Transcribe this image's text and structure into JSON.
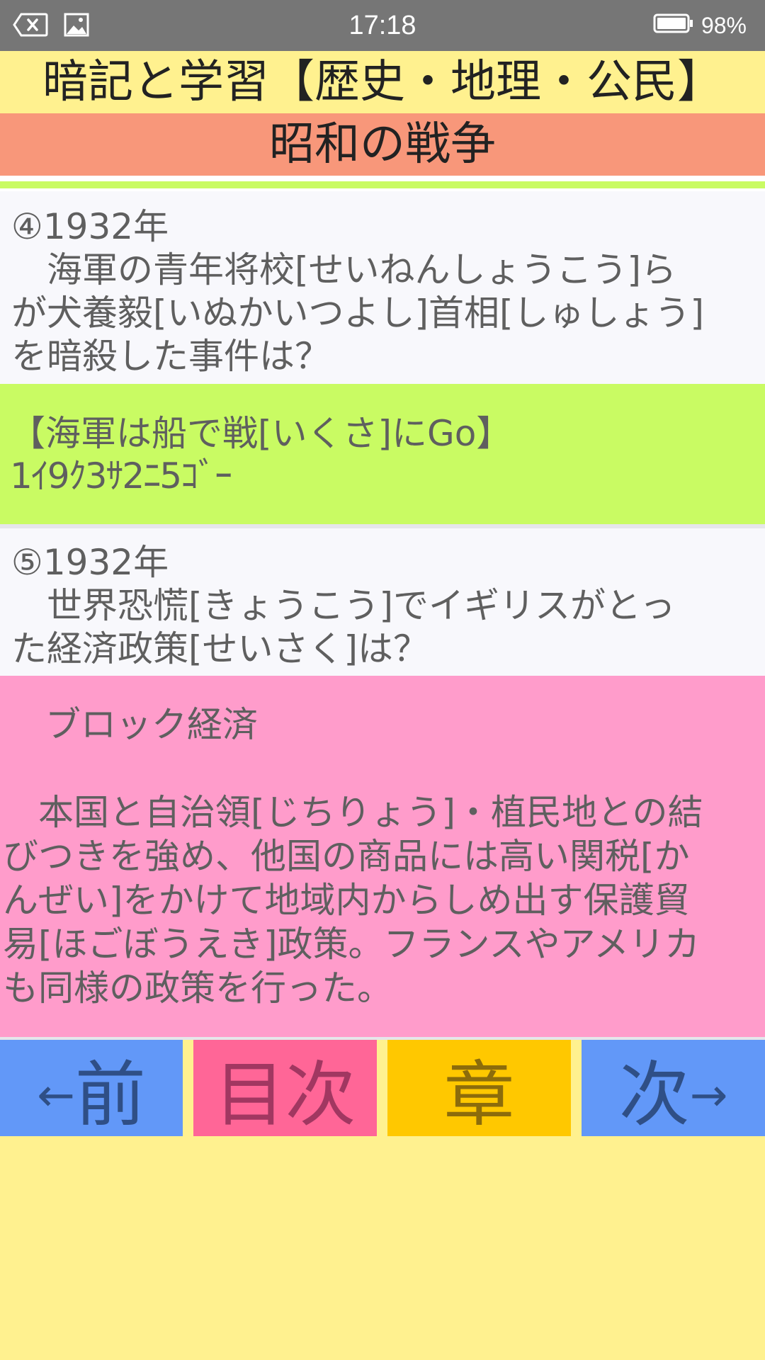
{
  "status_bar": {
    "time": "17:18",
    "battery_percent": "98%",
    "color": "#767676"
  },
  "app_title": "暗記と学習【歴史・地理・公民】",
  "chapter_title": "昭和の戦争",
  "question4": {
    "number_year": "④1932年",
    "lines": [
      "　海軍の青年将校[せいねんしょうこう]ら",
      "が犬養毅[いぬかいつよし]首相[しゅしょう]",
      "を暗殺した事件は？"
    ]
  },
  "hint4": {
    "mnemonic": "【海軍は船で戦[いくさ]にGo】",
    "reading": "1ｲ9ｸ3ｻ2ﾆ5ｺﾞｰ"
  },
  "question5": {
    "number_year": "⑤1932年",
    "lines": [
      "　世界恐慌[きょうこう]でイギリスがとっ",
      "た経済政策[せいさく]は？"
    ]
  },
  "answer5": {
    "answer": "　ブロック経済",
    "explanation_lines": [
      "　本国と自治領[じちりょう]・植民地との結",
      "びつきを強め、他国の商品には高い関税[か",
      "んぜい]をかけて地域内からしめ出す保護貿",
      "易[ほごぼうえき]政策。フランスやアメリカ",
      "も同様の政策を行った。"
    ]
  },
  "nav": {
    "prev_arrow": "←",
    "prev_label": "前",
    "toc_label": "目次",
    "chapter_label": "章",
    "next_label": "次",
    "next_arrow": "→"
  },
  "colors": {
    "app_background": "#FFF18F",
    "chapter_bar": "#F8977A",
    "question_bg": "#F8F8FC",
    "hint_bg": "#C9FB63",
    "answer_bg": "#FF9CCB",
    "nav_prev": "#6298F8",
    "nav_toc": "#FF6697",
    "nav_chapter": "#FFC800",
    "nav_next": "#6298F8"
  }
}
